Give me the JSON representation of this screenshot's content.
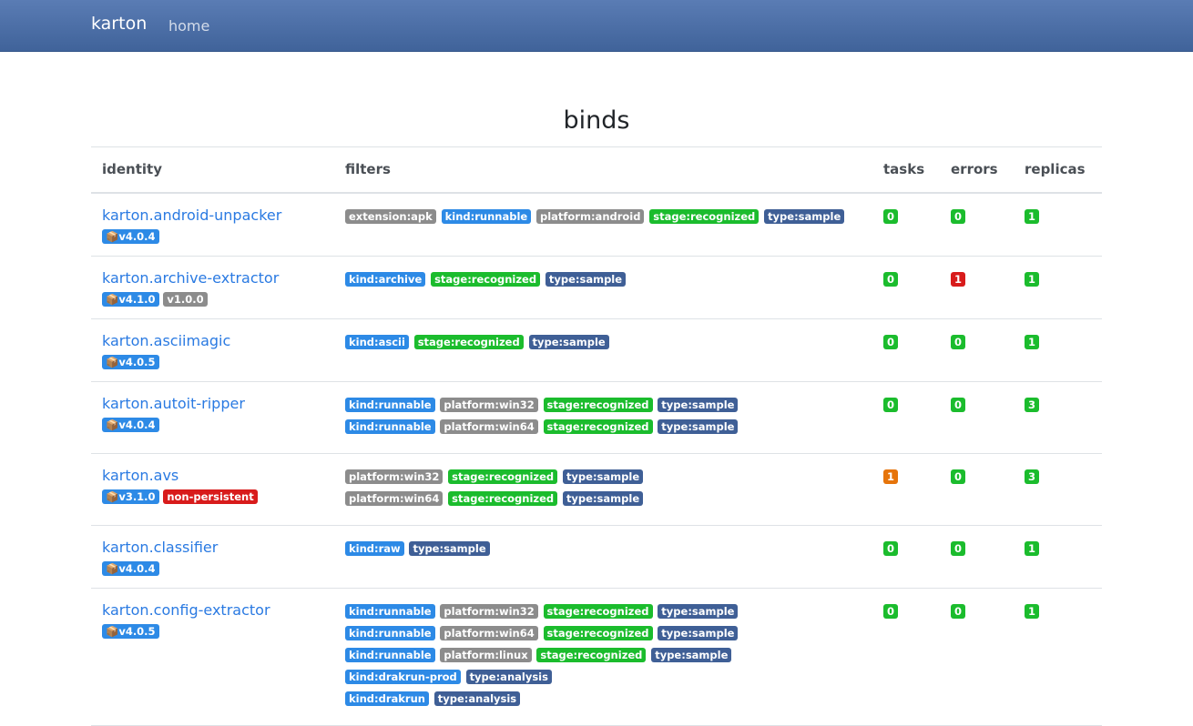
{
  "navbar": {
    "brand": "karton",
    "home": "home"
  },
  "page_title": "binds",
  "table": {
    "columns": [
      "identity",
      "filters",
      "tasks",
      "errors",
      "replicas"
    ],
    "rows": [
      {
        "identity": "karton.android-unpacker",
        "badges": [
          {
            "text": "📦v4.0.4",
            "color": "blue"
          }
        ],
        "filters": [
          [
            {
              "text": "extension:apk",
              "color": "gray"
            },
            {
              "text": "kind:runnable",
              "color": "blue"
            },
            {
              "text": "platform:android",
              "color": "gray"
            },
            {
              "text": "stage:recognized",
              "color": "green"
            },
            {
              "text": "type:sample",
              "color": "navy"
            }
          ]
        ],
        "tasks": "0",
        "tasks_color": "green",
        "errors": "0",
        "errors_color": "green",
        "replicas": "1",
        "replicas_color": "green"
      },
      {
        "identity": "karton.archive-extractor",
        "badges": [
          {
            "text": "📦v4.1.0",
            "color": "blue"
          },
          {
            "text": "v1.0.0",
            "color": "gray"
          }
        ],
        "filters": [
          [
            {
              "text": "kind:archive",
              "color": "blue"
            },
            {
              "text": "stage:recognized",
              "color": "green"
            },
            {
              "text": "type:sample",
              "color": "navy"
            }
          ]
        ],
        "tasks": "0",
        "tasks_color": "green",
        "errors": "1",
        "errors_color": "red",
        "replicas": "1",
        "replicas_color": "green"
      },
      {
        "identity": "karton.asciimagic",
        "badges": [
          {
            "text": "📦v4.0.5",
            "color": "blue"
          }
        ],
        "filters": [
          [
            {
              "text": "kind:ascii",
              "color": "blue"
            },
            {
              "text": "stage:recognized",
              "color": "green"
            },
            {
              "text": "type:sample",
              "color": "navy"
            }
          ]
        ],
        "tasks": "0",
        "tasks_color": "green",
        "errors": "0",
        "errors_color": "green",
        "replicas": "1",
        "replicas_color": "green"
      },
      {
        "identity": "karton.autoit-ripper",
        "badges": [
          {
            "text": "📦v4.0.4",
            "color": "blue"
          }
        ],
        "filters": [
          [
            {
              "text": "kind:runnable",
              "color": "blue"
            },
            {
              "text": "platform:win32",
              "color": "gray"
            },
            {
              "text": "stage:recognized",
              "color": "green"
            },
            {
              "text": "type:sample",
              "color": "navy"
            }
          ],
          [
            {
              "text": "kind:runnable",
              "color": "blue"
            },
            {
              "text": "platform:win64",
              "color": "gray"
            },
            {
              "text": "stage:recognized",
              "color": "green"
            },
            {
              "text": "type:sample",
              "color": "navy"
            }
          ]
        ],
        "tasks": "0",
        "tasks_color": "green",
        "errors": "0",
        "errors_color": "green",
        "replicas": "3",
        "replicas_color": "green"
      },
      {
        "identity": "karton.avs",
        "badges": [
          {
            "text": "📦v3.1.0",
            "color": "blue"
          },
          {
            "text": "non-persistent",
            "color": "red"
          }
        ],
        "filters": [
          [
            {
              "text": "platform:win32",
              "color": "gray"
            },
            {
              "text": "stage:recognized",
              "color": "green"
            },
            {
              "text": "type:sample",
              "color": "navy"
            }
          ],
          [
            {
              "text": "platform:win64",
              "color": "gray"
            },
            {
              "text": "stage:recognized",
              "color": "green"
            },
            {
              "text": "type:sample",
              "color": "navy"
            }
          ]
        ],
        "tasks": "1",
        "tasks_color": "orange",
        "errors": "0",
        "errors_color": "green",
        "replicas": "3",
        "replicas_color": "green"
      },
      {
        "identity": "karton.classifier",
        "badges": [
          {
            "text": "📦v4.0.4",
            "color": "blue"
          }
        ],
        "filters": [
          [
            {
              "text": "kind:raw",
              "color": "blue"
            },
            {
              "text": "type:sample",
              "color": "navy"
            }
          ]
        ],
        "tasks": "0",
        "tasks_color": "green",
        "errors": "0",
        "errors_color": "green",
        "replicas": "1",
        "replicas_color": "green"
      },
      {
        "identity": "karton.config-extractor",
        "badges": [
          {
            "text": "📦v4.0.5",
            "color": "blue"
          }
        ],
        "filters": [
          [
            {
              "text": "kind:runnable",
              "color": "blue"
            },
            {
              "text": "platform:win32",
              "color": "gray"
            },
            {
              "text": "stage:recognized",
              "color": "green"
            },
            {
              "text": "type:sample",
              "color": "navy"
            }
          ],
          [
            {
              "text": "kind:runnable",
              "color": "blue"
            },
            {
              "text": "platform:win64",
              "color": "gray"
            },
            {
              "text": "stage:recognized",
              "color": "green"
            },
            {
              "text": "type:sample",
              "color": "navy"
            }
          ],
          [
            {
              "text": "kind:runnable",
              "color": "blue"
            },
            {
              "text": "platform:linux",
              "color": "gray"
            },
            {
              "text": "stage:recognized",
              "color": "green"
            },
            {
              "text": "type:sample",
              "color": "navy"
            }
          ],
          [
            {
              "text": "kind:drakrun-prod",
              "color": "blue"
            },
            {
              "text": "type:analysis",
              "color": "navy"
            }
          ],
          [
            {
              "text": "kind:drakrun",
              "color": "blue"
            },
            {
              "text": "type:analysis",
              "color": "navy"
            }
          ]
        ],
        "tasks": "0",
        "tasks_color": "green",
        "errors": "0",
        "errors_color": "green",
        "replicas": "1",
        "replicas_color": "green"
      }
    ]
  },
  "colors": {
    "blue": "#2d8ae6",
    "gray": "#8c8c8c",
    "green": "#1bbc2d",
    "navy": "#3f5f96",
    "red": "#d81b1b",
    "orange": "#e6740a",
    "link": "#2a7ae2"
  }
}
